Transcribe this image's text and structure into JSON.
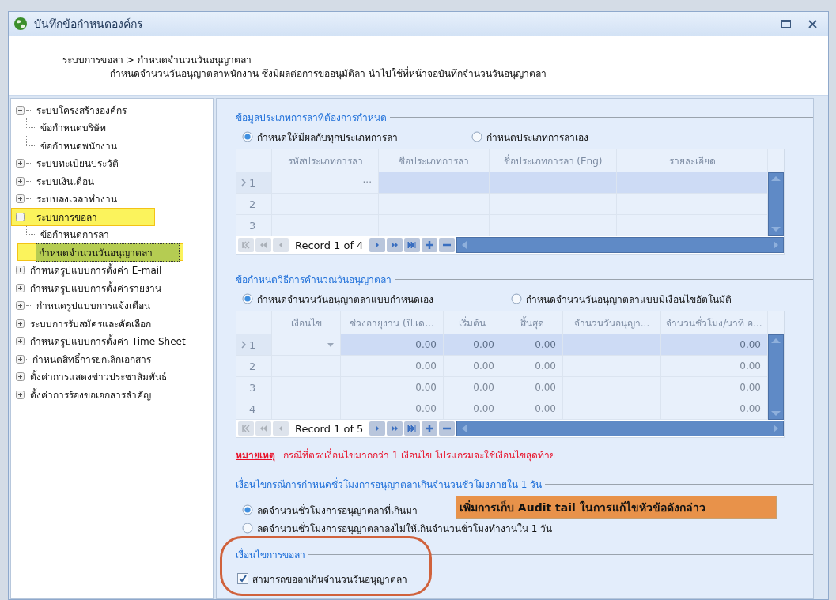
{
  "window": {
    "title": "บันทึกข้อกำหนดองค์กร"
  },
  "header": {
    "breadcrumb": "ระบบการขอลา > กำหนดจำนวนวันอนุญาตลา",
    "description": "กำหนดจำนวนวันอนุญาตลาพนักงาน ซึ่งมีผลต่อการขออนุมัติลา นำไปใช้ที่หน้าจอบันทึกจำนวนวันอนุญาตลา"
  },
  "tree": [
    {
      "label": "ระบบโครงสร้างองค์กร",
      "expanded": true,
      "highlighted": false,
      "children": [
        {
          "label": "ข้อกำหนดบริษัท",
          "selected": false,
          "highlighted": false
        },
        {
          "label": "ข้อกำหนดพนักงาน",
          "selected": false,
          "highlighted": false
        }
      ]
    },
    {
      "label": "ระบบทะเบียนประวัติ",
      "expanded": false,
      "highlighted": false
    },
    {
      "label": "ระบบเงินเดือน",
      "expanded": false,
      "highlighted": false
    },
    {
      "label": "ระบบลงเวลาทำงาน",
      "expanded": false,
      "highlighted": false
    },
    {
      "label": "ระบบการขอลา",
      "expanded": true,
      "highlighted": true,
      "children": [
        {
          "label": "ข้อกำหนดการลา",
          "selected": false,
          "highlighted": false
        },
        {
          "label": "กำหนดจำนวนวันอนุญาตลา",
          "selected": true,
          "highlighted": true
        }
      ]
    },
    {
      "label": "กำหนดรูปแบบการตั้งค่า E-mail",
      "expanded": false,
      "highlighted": false
    },
    {
      "label": "กำหนดรูปแบบการตั้งค่ารายงาน",
      "expanded": false,
      "highlighted": false
    },
    {
      "label": "กำหนดรูปแบบการแจ้งเตือน",
      "expanded": false,
      "highlighted": false
    },
    {
      "label": "ระบบการรับสมัครและคัดเลือก",
      "expanded": false,
      "highlighted": false
    },
    {
      "label": "กำหนดรูปแบบการตั้งค่า Time Sheet",
      "expanded": false,
      "highlighted": false
    },
    {
      "label": "กำหนดสิทธิ์การยกเลิกเอกสาร",
      "expanded": false,
      "highlighted": false
    },
    {
      "label": "ตั้งค่าการแสดงข่าวประชาสัมพันธ์",
      "expanded": false,
      "highlighted": false
    },
    {
      "label": "ตั้งค่าการร้องขอเอกสารสำคัญ",
      "expanded": false,
      "highlighted": false
    }
  ],
  "sections": [
    {
      "title": "ข้อมูลประเภทการลาที่ต้องการกำหนด",
      "options": [
        {
          "kind": "radio",
          "label": "กำหนดให้มีผลกับทุกประเภทการลา",
          "selected": true
        },
        {
          "kind": "radio",
          "label": "กำหนดประเภทการลาเอง",
          "selected": false
        }
      ],
      "grid": {
        "columns": [
          "รหัสประเภทการลา",
          "ชื่อประเภทการลา",
          "ชื่อประเภทการลา (Eng)",
          "รายละเอียด"
        ],
        "rows": [
          {
            "label": "1",
            "current": true,
            "selected": true,
            "cells": [
              "···",
              null,
              null,
              null
            ]
          },
          {
            "label": "2",
            "current": false,
            "selected": false,
            "cells": [
              null,
              null,
              null,
              null
            ]
          },
          {
            "label": "3",
            "current": false,
            "selected": false,
            "cells": [
              null,
              null,
              null,
              null
            ]
          }
        ],
        "navigator": "Record 1 of 4"
      }
    },
    {
      "title": "ข้อกำหนดวิธีการคำนวณวันอนุญาตลา",
      "options": [
        {
          "kind": "radio",
          "label": "กำหนดจำนวนวันอนุญาตลาแบบกำหนดเอง",
          "selected": true
        },
        {
          "kind": "radio",
          "label": "กำหนดจำนวนวันอนุญาตลาแบบมีเงื่อนไขอัตโนมัติ",
          "selected": false
        }
      ],
      "grid": {
        "columns": [
          "เงื่อนไข",
          "ช่วงอายุงาน (ปี.เด...",
          "เริ่มต้น",
          "สิ้นสุด",
          "จำนวนวันอนุญา...",
          "จำนวนชั่วโมง/นาที อ..."
        ],
        "rows": [
          {
            "label": "1",
            "current": true,
            "selected": true,
            "cells": [
              null,
              "0.00",
              "0.00",
              "0.00",
              null,
              "0.00"
            ]
          },
          {
            "label": "2",
            "current": false,
            "selected": false,
            "cells": [
              null,
              "0.00",
              "0.00",
              "0.00",
              null,
              "0.00"
            ]
          },
          {
            "label": "3",
            "current": false,
            "selected": false,
            "cells": [
              null,
              "0.00",
              "0.00",
              "0.00",
              null,
              "0.00"
            ]
          },
          {
            "label": "4",
            "current": false,
            "selected": false,
            "cells": [
              null,
              "0.00",
              "0.00",
              "0.00",
              null,
              "0.00"
            ]
          }
        ],
        "navigator": "Record 1 of 5"
      },
      "note": {
        "label": "หมายเหตุ",
        "text": "กรณีที่ตรงเงื่อนไขมากกว่า 1 เงื่อนไข โปรแกรมจะใช้เงื่อนไขสุดท้าย"
      }
    },
    {
      "title": "เงื่อนไขกรณีการกำหนดชั่วโมงการอนุญาตลาเกินจำนวนชั่วโมงภายใน 1 วัน",
      "options": [
        {
          "kind": "radio",
          "label": "ลดจำนวนชั่วโมงการอนุญาตลาที่เกินมา",
          "selected": true
        },
        {
          "kind": "radio",
          "label": "ลดจำนวนชั่วโมงการอนุญาตลาลงไม่ให้เกินจำนวนชั่วโมงทำงานใน 1 วัน",
          "selected": false
        }
      ],
      "annotation": "เพิ่มการเก็บ Audit tail ในการแก้ไขหัวข้อดังกล่าว"
    },
    {
      "title": "เงื่อนไขการขอลา",
      "options": [
        {
          "kind": "checkbox",
          "label": "สามารถขอลาเกินจำนวนวันอนุญาตลา",
          "checked": true
        }
      ]
    }
  ]
}
